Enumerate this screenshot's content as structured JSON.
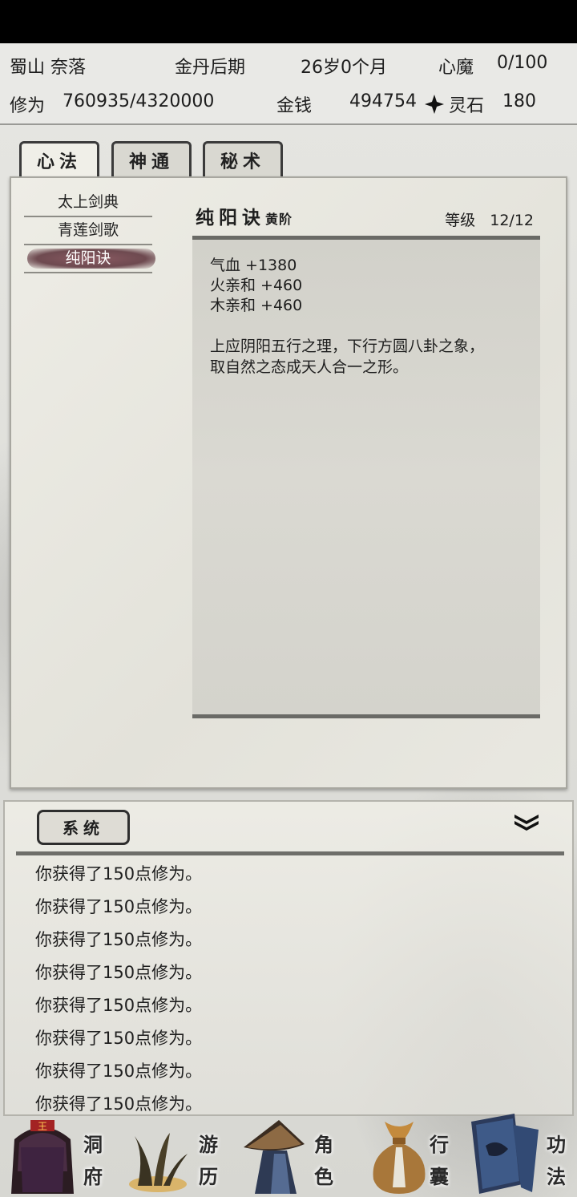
{
  "header": {
    "location": "蜀山 奈落",
    "realm": "金丹后期",
    "age": "26岁0个月",
    "heart_demon_label": "心魔",
    "heart_demon_value": "0/100",
    "cultivation_label": "修为",
    "cultivation_value": "760935/4320000",
    "money_label": "金钱",
    "money_value": "494754",
    "spirit_stone_label": "灵石",
    "spirit_stone_value": "180"
  },
  "tabs": [
    {
      "label": "心法",
      "active": true
    },
    {
      "label": "神通",
      "active": false
    },
    {
      "label": "秘术",
      "active": false
    }
  ],
  "skills": [
    {
      "name": "太上剑典",
      "selected": false
    },
    {
      "name": "青莲剑歌",
      "selected": false
    },
    {
      "name": "纯阳诀",
      "selected": true
    }
  ],
  "detail": {
    "title": "纯阳诀",
    "tier": "黄阶",
    "level_label": "等级",
    "level_value": "12/12",
    "stats": [
      "气血 +1380",
      "火亲和 +460",
      "木亲和 +460"
    ],
    "description_line1": "上应阴阳五行之理，下行方圆八卦之象，",
    "description_line2": "取自然之态成天人合一之形。"
  },
  "log": {
    "tab_label": "系统",
    "lines": [
      "你获得了150点修为。",
      "你获得了150点修为。",
      "你获得了150点修为。",
      "你获得了150点修为。",
      "你获得了150点修为。",
      "你获得了150点修为。",
      "你获得了150点修为。",
      "你获得了150点修为。"
    ]
  },
  "nav": [
    {
      "char1": "洞",
      "char2": "府",
      "icon": "cave-mansion-icon"
    },
    {
      "char1": "游",
      "char2": "历",
      "icon": "travel-grass-icon"
    },
    {
      "char1": "角",
      "char2": "色",
      "icon": "character-hat-icon"
    },
    {
      "char1": "行",
      "char2": "囊",
      "icon": "bag-pouch-icon"
    },
    {
      "char1": "功",
      "char2": "法",
      "icon": "books-icon"
    }
  ],
  "colors": {
    "selected_skill_bg": "#7a4f57",
    "tab_border": "#3b3b3b",
    "separator": "#6a6a66"
  }
}
